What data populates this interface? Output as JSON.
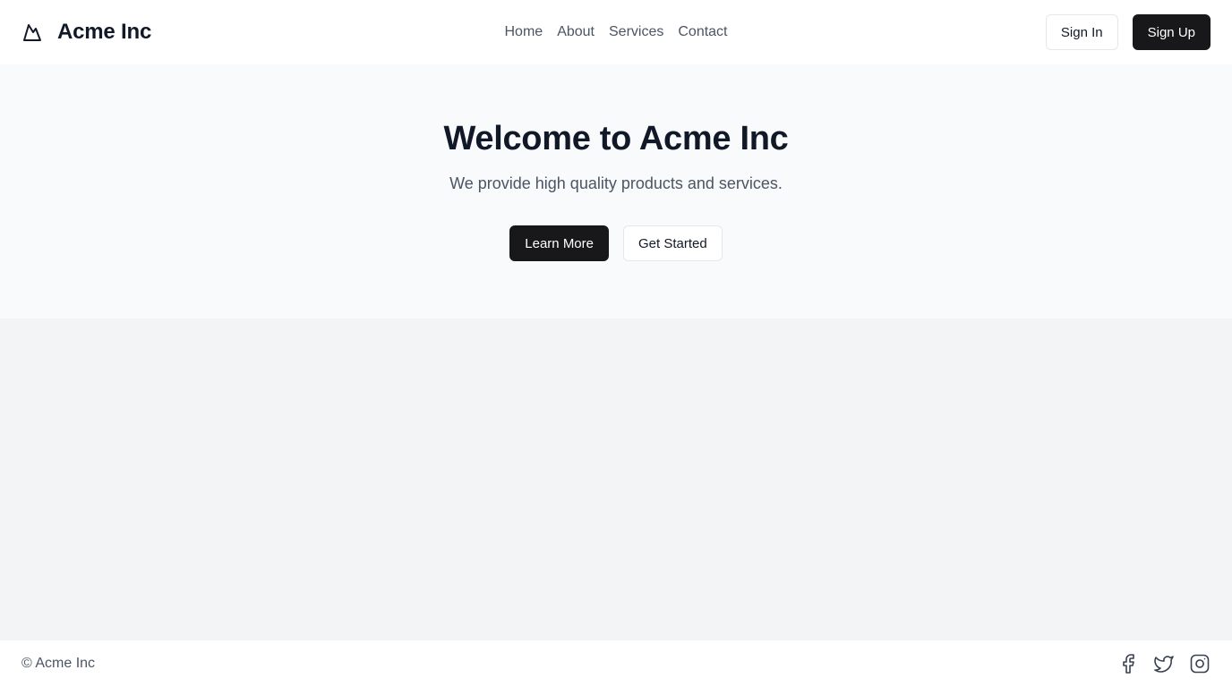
{
  "header": {
    "brand_name": "Acme Inc",
    "brand_icon": "mountain-icon",
    "nav": [
      {
        "label": "Home"
      },
      {
        "label": "About"
      },
      {
        "label": "Services"
      },
      {
        "label": "Contact"
      }
    ],
    "sign_in_label": "Sign In",
    "sign_up_label": "Sign Up"
  },
  "hero": {
    "title": "Welcome to Acme Inc",
    "subtitle": "We provide high quality products and services.",
    "learn_more_label": "Learn More",
    "get_started_label": "Get Started"
  },
  "footer": {
    "copyright": "© Acme Inc",
    "socials": [
      {
        "icon": "facebook-icon"
      },
      {
        "icon": "twitter-icon"
      },
      {
        "icon": "instagram-icon"
      }
    ]
  },
  "colors": {
    "primary_button": "#18181b",
    "hero_background": "#f8fafc",
    "page_background": "#f3f4f6",
    "text": "#111827",
    "muted_text": "#4b5563"
  }
}
